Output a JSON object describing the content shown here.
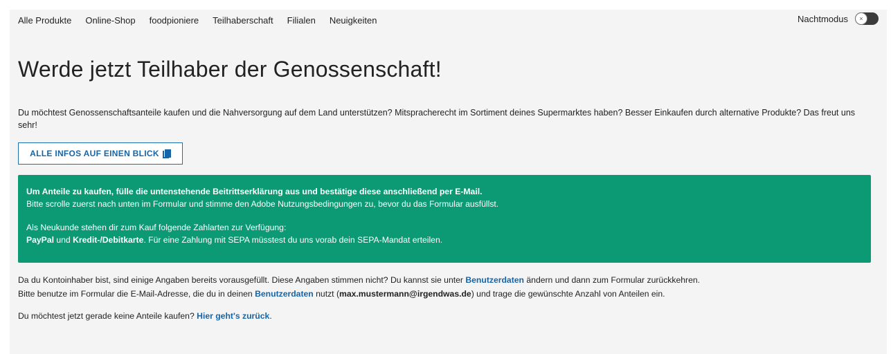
{
  "nav": {
    "items": [
      "Alle Produkte",
      "Online-Shop",
      "foodpioniere",
      "Teilhaberschaft",
      "Filialen",
      "Neuigkeiten"
    ],
    "nightmode_label": "Nachtmodus",
    "toggle_glyph": "×"
  },
  "heading": "Werde jetzt Teilhaber der Genossenschaft!",
  "intro": "Du möchtest Genossenschaftsanteile kaufen und die Nahversorgung auf dem Land unterstützen? Mitspracherecht im Sortiment deines Supermarktes haben? Besser Einkaufen durch alternative Produkte? Das freut uns sehr!",
  "info_button": {
    "label": "ALLE INFOS AUF EINEN BLICK",
    "icon": "document-icon"
  },
  "notice": {
    "line1_bold": "Um Anteile zu kaufen, fülle die untenstehende Beitrittserklärung aus und bestätige diese anschließend per E-Mail.",
    "line2": "Bitte scrolle zuerst nach unten im Formular und stimme den Adobe Nutzungsbedingungen zu, bevor du das Formular ausfüllst.",
    "line3": "Als Neukunde stehen dir zum Kauf folgende Zahlarten zur Verfügung:",
    "line4_bold1": "PayPal",
    "line4_mid": " und ",
    "line4_bold2": "Kredit-/Debitkarte",
    "line4_rest": ". Für eine Zahlung mit SEPA müsstest du uns vorab dein SEPA-Mandat erteilen."
  },
  "body": {
    "p1_a": "Da du Kontoinhaber bist, sind einige Angaben bereits vorausgefüllt. Diese Angaben stimmen nicht? Du kannst sie unter ",
    "p1_link": "Benutzerdaten",
    "p1_b": " ändern und dann zum Formular zurückkehren.",
    "p2_a": "Bitte benutze im Formular die E-Mail-Adresse, die du in deinen ",
    "p2_link": "Benutzerdaten",
    "p2_b": " nutzt (",
    "p2_email": "max.mustermann@irgendwas.de",
    "p2_c": ") und trage die gewünschte Anzahl von Anteilen ein.",
    "p3_a": "Du möchtest jetzt gerade keine Anteile kaufen? ",
    "p3_link": "Hier geht's zurück",
    "p3_b": "."
  },
  "colors": {
    "accent_blue": "#1565a8",
    "notice_green": "#0b9a74"
  }
}
